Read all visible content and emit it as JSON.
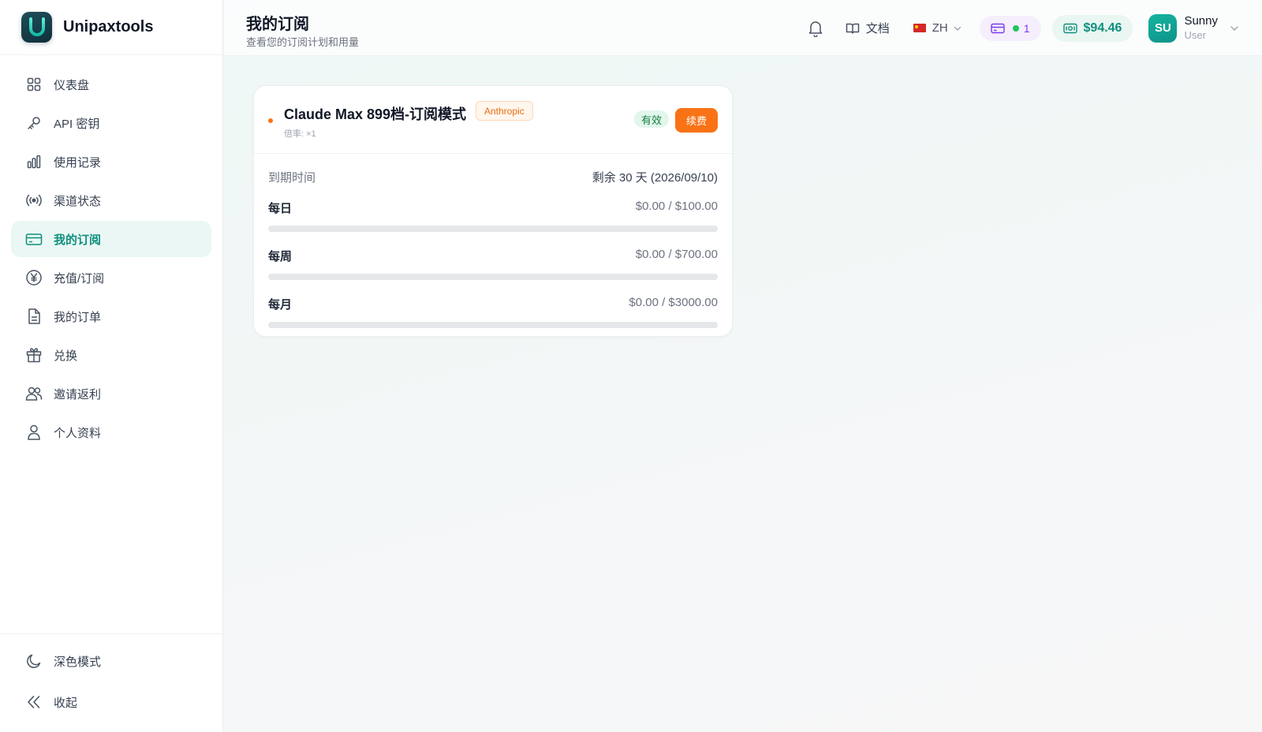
{
  "brand": {
    "name": "Unipaxtools"
  },
  "sidebar": {
    "items": [
      {
        "label": "仪表盘",
        "icon": "grid-icon"
      },
      {
        "label": "API 密钥",
        "icon": "key-icon"
      },
      {
        "label": "使用记录",
        "icon": "bar-chart-icon"
      },
      {
        "label": "渠道状态",
        "icon": "broadcast-icon"
      },
      {
        "label": "我的订阅",
        "icon": "credit-card-icon",
        "active": true
      },
      {
        "label": "充值/订阅",
        "icon": "yen-circle-icon"
      },
      {
        "label": "我的订单",
        "icon": "document-icon"
      },
      {
        "label": "兑换",
        "icon": "gift-icon"
      },
      {
        "label": "邀请返利",
        "icon": "users-icon"
      },
      {
        "label": "个人资料",
        "icon": "user-icon"
      }
    ],
    "bottom": [
      {
        "label": "深色模式",
        "icon": "moon-icon"
      },
      {
        "label": "收起",
        "icon": "double-chevron-left-icon"
      }
    ]
  },
  "header": {
    "title": "我的订阅",
    "subtitle": "查看您的订阅计划和用量",
    "docs_label": "文档",
    "lang": "ZH",
    "subscription_count": "1",
    "balance": "$94.46",
    "user": {
      "initials": "SU",
      "name": "Sunny",
      "role": "User"
    }
  },
  "subscription": {
    "plan_name": "Claude Max 899档-订阅模式",
    "provider": "Anthropic",
    "rate": "倍率: ×1",
    "status": "有效",
    "renew_label": "续费",
    "expiry_label": "到期时间",
    "expiry_value": "剩余 30 天 (2026/09/10)",
    "usage": [
      {
        "label": "每日",
        "value": "$0.00 / $100.00",
        "fraction": 0
      },
      {
        "label": "每周",
        "value": "$0.00 / $700.00",
        "fraction": 0
      },
      {
        "label": "每月",
        "value": "$0.00 / $3000.00",
        "fraction": 0
      }
    ]
  },
  "colors": {
    "accent": "#0f8f7d",
    "orange": "#f97316",
    "active_bg": "#eaf7f4"
  }
}
